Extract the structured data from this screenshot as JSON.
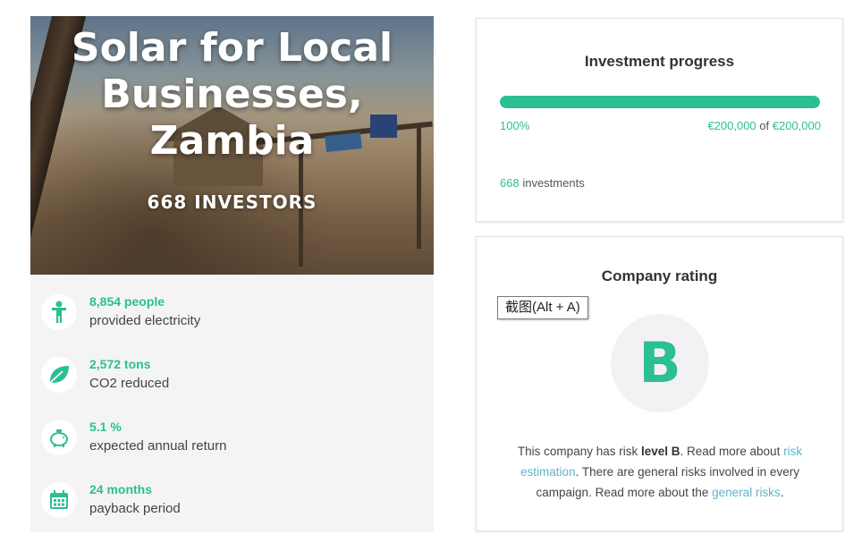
{
  "project": {
    "title_line1": "Solar for Local",
    "title_line2": "Businesses,",
    "title_line3": "Zambia",
    "investors_label": "668 INVESTORS"
  },
  "stats": [
    {
      "icon": "person-icon",
      "value": "8,854 people",
      "label": "provided electricity"
    },
    {
      "icon": "leaf-icon",
      "value": "2,572 tons",
      "label": "CO2 reduced"
    },
    {
      "icon": "piggy-bank-icon",
      "value": "5.1 %",
      "label": "expected annual return"
    },
    {
      "icon": "calendar-icon",
      "value": "24 months",
      "label": "payback period"
    }
  ],
  "progress": {
    "title": "Investment progress",
    "fraction": 1.0,
    "percent_label": "100%",
    "raised": "€200,000",
    "of": "of",
    "goal": "€200,000",
    "investments_count": "668",
    "investments_label": "investments"
  },
  "rating": {
    "title": "Company rating",
    "letter": "B",
    "text_part1": "This company has risk ",
    "level_text": "level B",
    "text_part2": ". Read more about ",
    "link_risk": "risk estimation",
    "text_part3": ". There are general risks involved in every campaign. Read more about the ",
    "link_general": "general risks",
    "text_part4": "."
  },
  "tooltip": {
    "text": "截图(Alt + A)"
  },
  "colors": {
    "accent": "#2bbf93",
    "link": "#5fb5cc",
    "track": "#dfeee9"
  }
}
